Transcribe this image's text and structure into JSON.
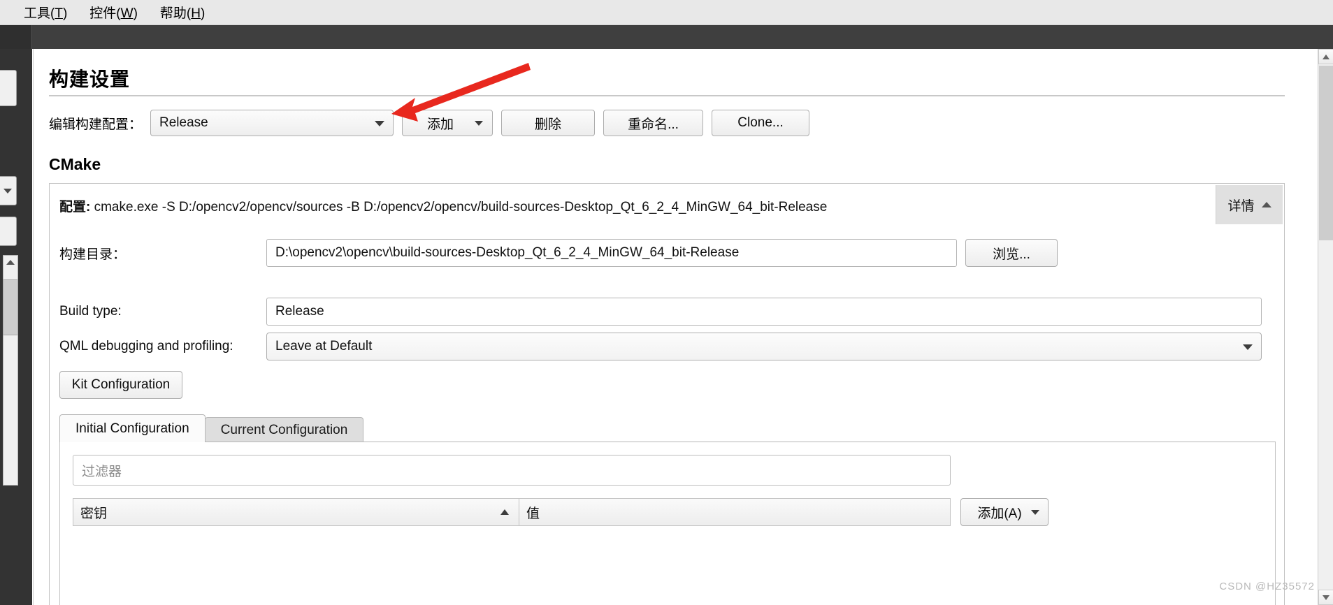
{
  "menubar": {
    "items": [
      {
        "label": "工具",
        "accel": "T"
      },
      {
        "label": "控件",
        "accel": "W"
      },
      {
        "label": "帮助",
        "accel": "H"
      }
    ]
  },
  "page": {
    "title": "构建设置"
  },
  "config_row": {
    "label": "编辑构建配置：",
    "combo_value": "Release",
    "add_button": "添加",
    "delete_button": "删除",
    "rename_button": "重命名...",
    "clone_button": "Clone..."
  },
  "cmake": {
    "section_title": "CMake",
    "configure_label": "配置:",
    "configure_command": "cmake.exe -S D:/opencv2/opencv/sources -B D:/opencv2/opencv/build-sources-Desktop_Qt_6_2_4_MinGW_64_bit-Release",
    "details_button": "详情",
    "build_dir_label": "构建目录：",
    "build_dir_value": "D:\\opencv2\\opencv\\build-sources-Desktop_Qt_6_2_4_MinGW_64_bit-Release",
    "browse_button": "浏览...",
    "build_type_label": "Build type:",
    "build_type_value": "Release",
    "qml_label": "QML debugging and profiling:",
    "qml_value": "Leave at Default",
    "kit_configuration_button": "Kit Configuration",
    "tabs": [
      {
        "label": "Initial Configuration",
        "active": true
      },
      {
        "label": "Current Configuration",
        "active": false
      }
    ],
    "filter_placeholder": "过滤器",
    "table": {
      "columns": [
        "密钥",
        "值"
      ],
      "sort_column": "密钥",
      "sort_direction": "ascending",
      "rows": []
    },
    "add_value_button": "添加(A)"
  },
  "watermark": "CSDN @HZ35572",
  "colors": {
    "annotation_arrow": "#e8281e",
    "dark_toolbar": "#3f3f3f",
    "dark_gutter": "#333333",
    "menubar_bg": "#e8e8e8",
    "active_tab_bg": "#fbfbfb",
    "inactive_tab_bg": "#dedede"
  }
}
